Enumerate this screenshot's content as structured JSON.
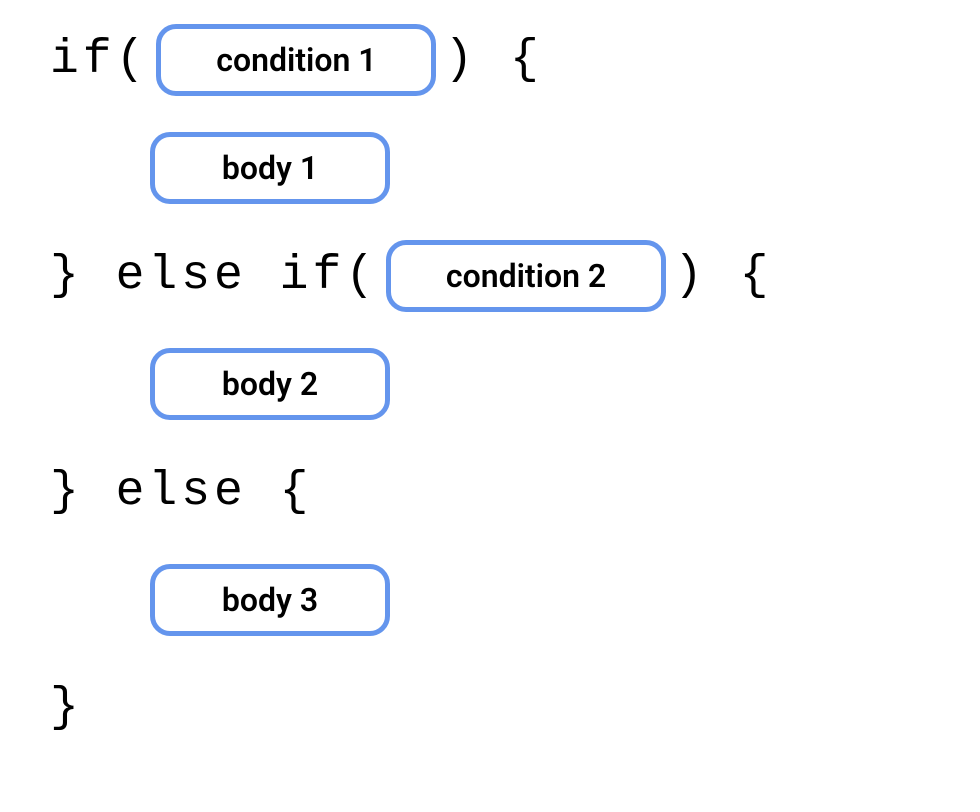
{
  "code": {
    "if_open": "if(",
    "close_paren_brace": ") {",
    "else_if_open": "} else if(",
    "else_brace": "} else {",
    "close_brace": "}"
  },
  "slots": {
    "condition1": "condition 1",
    "body1": "body 1",
    "condition2": "condition 2",
    "body2": "body 2",
    "body3": "body 3"
  }
}
